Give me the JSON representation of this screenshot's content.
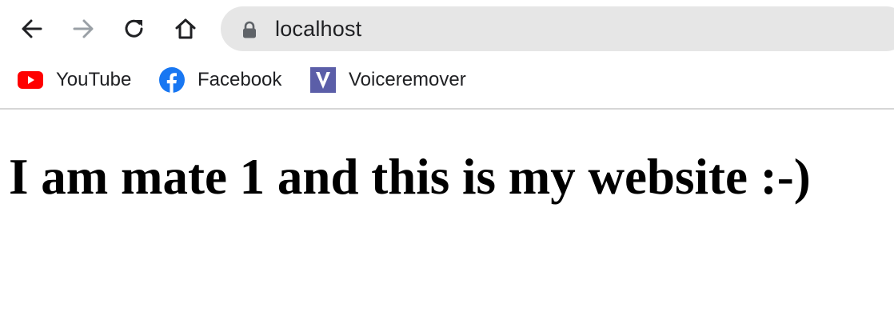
{
  "browser": {
    "address_bar": {
      "url": "localhost"
    },
    "bookmarks": [
      {
        "label": "YouTube",
        "icon": "youtube-icon"
      },
      {
        "label": "Facebook",
        "icon": "facebook-icon"
      },
      {
        "label": "Voiceremover",
        "icon": "voiceremover-icon",
        "icon_letter": "V"
      }
    ]
  },
  "page": {
    "heading": "I am mate 1 and this is my website :-)"
  },
  "colors": {
    "youtube_red": "#ff0000",
    "facebook_blue": "#1877f2",
    "voiceremover_purple": "#5b5ea8",
    "omnibox_bg": "#e6e6e6"
  }
}
